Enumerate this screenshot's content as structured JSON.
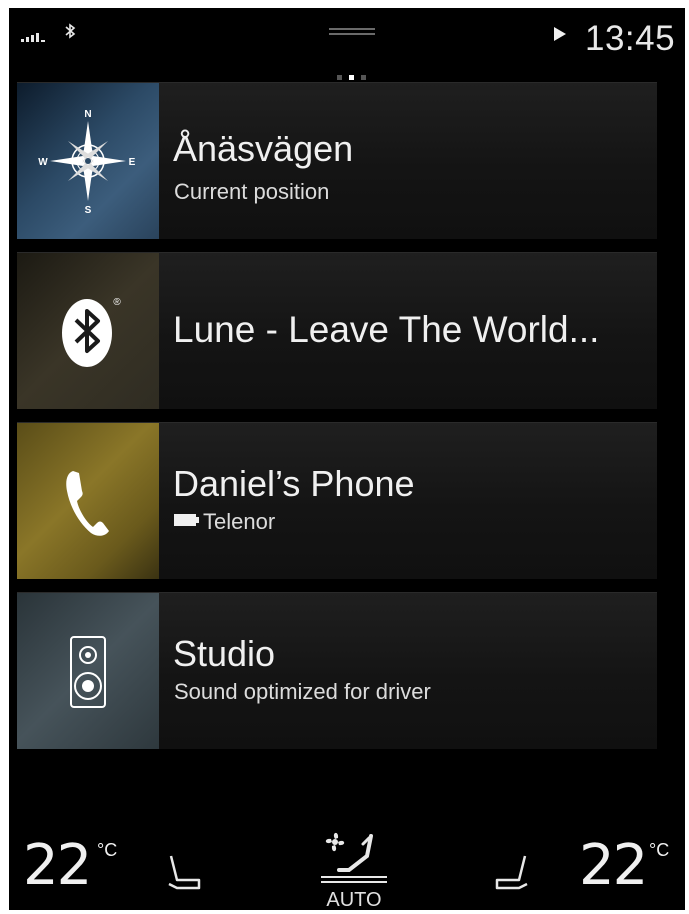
{
  "status_bar": {
    "time": "13:45",
    "icons": [
      "signal-icon",
      "bluetooth-icon",
      "drag-handle-icon",
      "play-icon"
    ]
  },
  "page_indicator": {
    "count": 3,
    "active_index": 1
  },
  "tiles": [
    {
      "icon": "compass-icon",
      "title": "Ånäsvägen",
      "subtitle": "Current position",
      "compass_letters": [
        "N",
        "E",
        "S",
        "W"
      ]
    },
    {
      "icon": "bluetooth-icon",
      "title": "Lune - Leave The World...",
      "subtitle": "",
      "registered_mark": "®"
    },
    {
      "icon": "phone-icon",
      "title": "Daniel’s Phone",
      "subtitle": "Telenor",
      "status_icon": "battery-icon"
    },
    {
      "icon": "speaker-icon",
      "title": "Studio",
      "subtitle": "Sound optimized for driver"
    }
  ],
  "climate": {
    "left_temp": "22",
    "right_temp": "22",
    "unit": "°C",
    "auto_label": "AUTO",
    "icons": [
      "seat-left-icon",
      "fan-auto-icon",
      "seat-right-icon"
    ]
  },
  "colors": {
    "background": "#000000",
    "tile": "#161616",
    "text": "#f0f0f0",
    "nav_tile": "#3c5d7c",
    "media_tile": "#3a3527",
    "phone_tile": "#8a7628",
    "audio_tile": "#46535a"
  }
}
